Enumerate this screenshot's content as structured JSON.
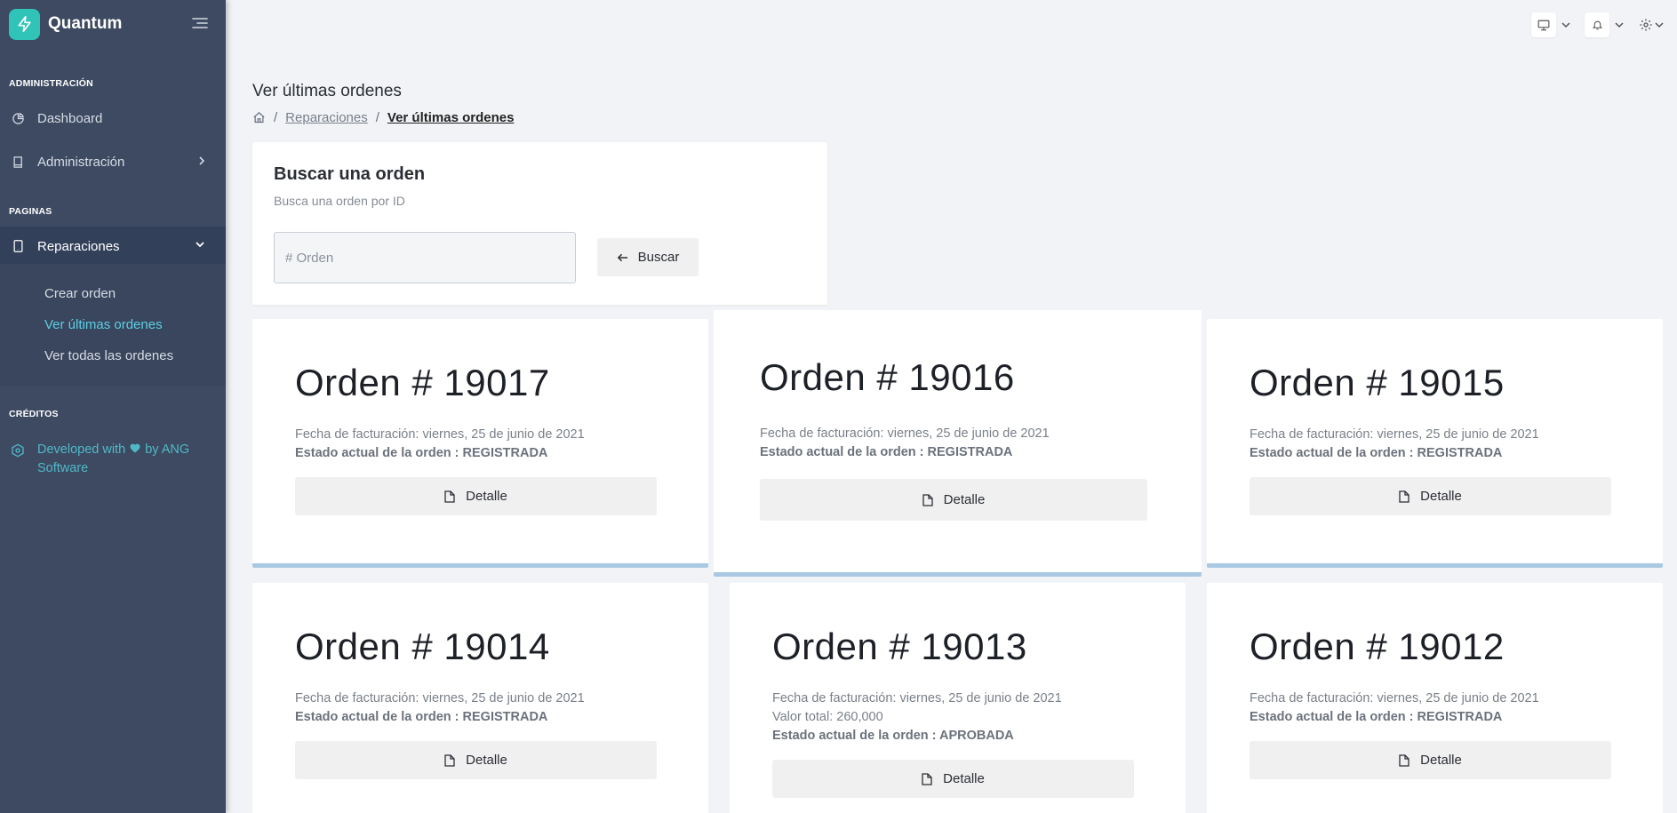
{
  "app": {
    "name": "Quantum"
  },
  "sidebar": {
    "sections": {
      "admin": "ADMINISTRACIÓN",
      "pages": "PAGINAS",
      "credits": "CRÉDITOS"
    },
    "items": {
      "dashboard": "Dashboard",
      "administracion": "Administración",
      "reparaciones": "Reparaciones"
    },
    "submenu": {
      "crear": "Crear orden",
      "ultimas": "Ver últimas ordenes",
      "todas": "Ver todas las ordenes"
    },
    "credits_text": {
      "line1": "Developed with",
      "by": "by ANG",
      "line2": "Software"
    }
  },
  "page": {
    "title": "Ver últimas ordenes",
    "breadcrumb": [
      "Reparaciones",
      "Ver últimas ordenes"
    ]
  },
  "search": {
    "title": "Buscar una orden",
    "subtitle": "Busca una orden por ID",
    "placeholder": "# Orden",
    "button": "Buscar"
  },
  "orders": [
    {
      "title": "Orden # 19017",
      "fecha": "Fecha de facturación: viernes, 25 de junio de 2021",
      "estado": "Estado actual de la orden : REGISTRADA",
      "button": "Detalle"
    },
    {
      "title": "Orden # 19016",
      "fecha": "Fecha de facturación: viernes, 25 de junio de 2021",
      "estado": "Estado actual de la orden : REGISTRADA",
      "button": "Detalle"
    },
    {
      "title": "Orden # 19015",
      "fecha": "Fecha de facturación: viernes, 25 de junio de 2021",
      "estado": "Estado actual de la orden : REGISTRADA",
      "button": "Detalle"
    },
    {
      "title": "Orden # 19014",
      "fecha": "Fecha de facturación: viernes, 25 de junio de 2021",
      "estado": "Estado actual de la orden : REGISTRADA",
      "button": "Detalle"
    },
    {
      "title": "Orden # 19013",
      "fecha": "Fecha de facturación: viernes, 25 de junio de 2021",
      "valor": "Valor total: 260,000",
      "estado": "Estado actual de la orden : APROBADA",
      "button": "Detalle"
    },
    {
      "title": "Orden # 19012",
      "fecha": "Fecha de facturación: viernes, 25 de junio de 2021",
      "estado": "Estado actual de la orden : REGISTRADA",
      "button": "Detalle"
    }
  ],
  "colors": {
    "sidebar": "#3d4a61",
    "accent": "#2fc4b7",
    "link_active": "#5ad0e6",
    "card_bar": "#a9c8e2"
  },
  "icons": [
    "bolt-icon",
    "menu-icon",
    "pie-chart-icon",
    "book-icon",
    "chevron-right-icon",
    "tablet-icon",
    "chevron-down-icon",
    "code-icon",
    "heart-icon",
    "monitor-icon",
    "bell-icon",
    "gear-icon",
    "home-icon",
    "arrow-left-icon",
    "file-icon"
  ]
}
